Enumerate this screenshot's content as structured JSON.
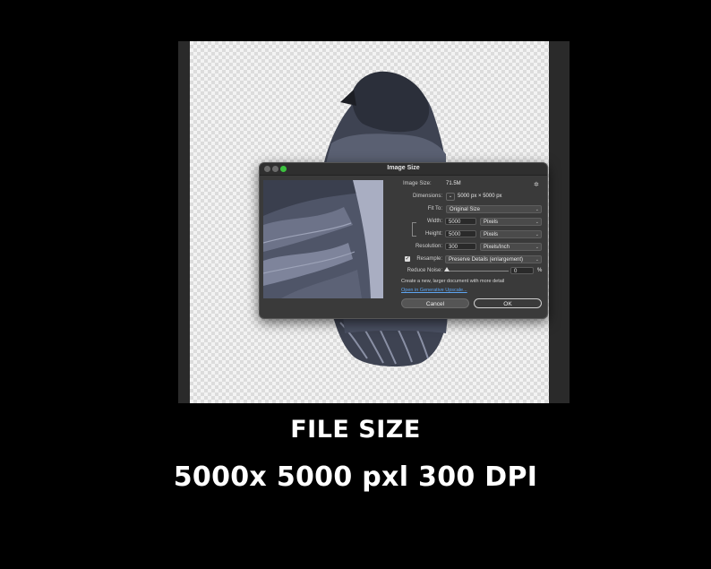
{
  "dialog": {
    "title": "Image Size",
    "image_size_label": "Image Size:",
    "image_size_value": "71.5M",
    "dimensions_label": "Dimensions:",
    "dimensions_value": "5000 px  ×  5000 px",
    "fit_to_label": "Fit To:",
    "fit_to_value": "Original Size",
    "width_label": "Width:",
    "width_value": "5000",
    "width_unit": "Pixels",
    "height_label": "Height:",
    "height_value": "5000",
    "height_unit": "Pixels",
    "resolution_label": "Resolution:",
    "resolution_value": "300",
    "resolution_unit": "Pixels/Inch",
    "resample_label": "Resample:",
    "resample_value": "Preserve Details (enlargement)",
    "resample_checked": true,
    "reduce_noise_label": "Reduce Noise:",
    "reduce_noise_value": "0",
    "reduce_noise_unit": "%",
    "note": "Create a new, larger document with more detail",
    "link": "Open in Generative Upscale...",
    "cancel_label": "Cancel",
    "ok_label": "OK",
    "check_glyph": "✓",
    "chevron_glyph": "⌄",
    "gear_glyph": "✲"
  },
  "caption": {
    "line1": "FILE SIZE",
    "line2": "5000x 5000 pxl 300 DPI"
  },
  "colors": {
    "background": "#000000",
    "dialog_bg": "#3a3a3a",
    "accent_green": "#3cc23f",
    "link_blue": "#5da4f0"
  }
}
